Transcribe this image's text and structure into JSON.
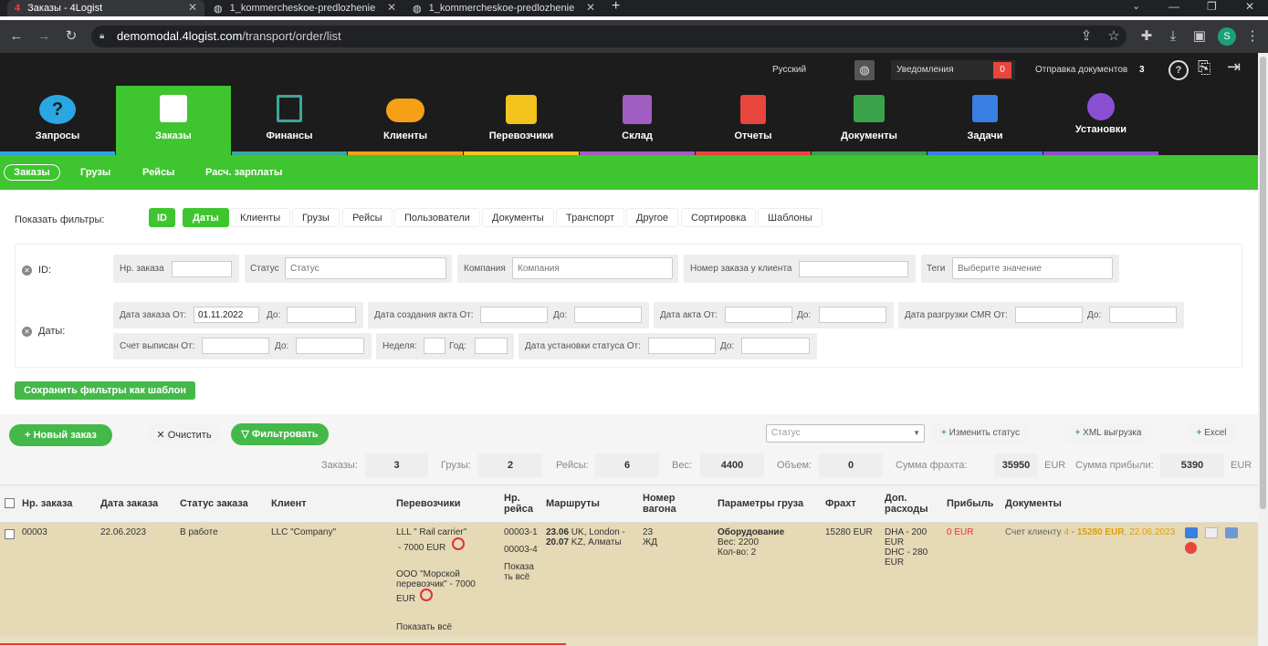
{
  "browser": {
    "tabs": [
      {
        "label": "Заказы - 4Logist"
      },
      {
        "label": "1_kommercheskoe-predlozhenie"
      },
      {
        "label": "1_kommercheskoe-predlozhenie"
      }
    ],
    "url_host": "demomodal.4logist.com",
    "url_path": "/transport/order/list",
    "profile_initial": "S"
  },
  "topbar": {
    "language": "Русский",
    "notifications_label": "Уведомления",
    "notifications_count": "0",
    "docs_label": "Отправка документов",
    "docs_count": "3"
  },
  "nav": [
    {
      "label": "Запросы",
      "color": "#2aa7e3"
    },
    {
      "label": "Заказы",
      "color": "#3fc52f"
    },
    {
      "label": "Финансы",
      "color": "#3aa79a"
    },
    {
      "label": "Клиенты",
      "color": "#f6a018"
    },
    {
      "label": "Перевозчики",
      "color": "#f3c31e"
    },
    {
      "label": "Склад",
      "color": "#a05ec2"
    },
    {
      "label": "Отчеты",
      "color": "#e8453c"
    },
    {
      "label": "Документы",
      "color": "#3aa34a"
    },
    {
      "label": "Задачи",
      "color": "#3a7fe3"
    },
    {
      "label": "Установки",
      "color": "#8a4fd3"
    }
  ],
  "subnav": [
    "Заказы",
    "Грузы",
    "Рейсы",
    "Расч. зарплаты"
  ],
  "filters": {
    "show_label": "Показать фильтры:",
    "buttons": [
      "ID",
      "Даты",
      "Клиенты",
      "Грузы",
      "Рейсы",
      "Пользователи",
      "Документы",
      "Транспорт",
      "Другое",
      "Сортировка",
      "Шаблоны"
    ],
    "id_row": {
      "title": "ID:",
      "order_no": "Нр. заказа",
      "status": "Статус",
      "status_ph": "Статус",
      "company": "Компания",
      "company_ph": "Компания",
      "client_order": "Номер заказа у клиента",
      "tags": "Теги",
      "tags_ph": "Выберите значение"
    },
    "dates_row": {
      "title": "Даты:",
      "order_date_from": "Дата заказа От:",
      "order_date_value": "01.11.2022",
      "to": "До:",
      "act_created_from": "Дата создания акта От:",
      "act_date_from": "Дата акта От:",
      "cmr_from": "Дата разгрузки CMR От:",
      "invoice_from": "Счет выписан От:",
      "week": "Неделя:",
      "year": "Год:",
      "status_date_from": "Дата установки статуса От:"
    },
    "save_template": "Сохранить фильтры как шаблон"
  },
  "actions": {
    "new_order": "Новый заказ",
    "clear": "Очистить",
    "filter": "Фильтровать",
    "status_select": "Статус",
    "change_status": "Изменить статус",
    "xml": "XML выгрузка",
    "excel": "Excel"
  },
  "stats": {
    "orders_label": "Заказы:",
    "orders": "3",
    "cargo_label": "Грузы:",
    "cargo": "2",
    "trips_label": "Рейсы:",
    "trips": "6",
    "weight_label": "Вес:",
    "weight": "4400",
    "volume_label": "Объем:",
    "volume": "0",
    "freight_label": "Сумма фрахта:",
    "freight": "35950",
    "freight_cur": "EUR",
    "profit_label": "Сумма прибыли:",
    "profit": "5390",
    "profit_cur": "EUR"
  },
  "table": {
    "headers": [
      "Нр. заказа",
      "Дата заказа",
      "Статус заказа",
      "Клиент",
      "Перевозчики",
      "Нр. рейса",
      "Маршруты",
      "Номер вагона",
      "Параметры груза",
      "Фрахт",
      "Доп. расходы",
      "Прибыль",
      "Документы"
    ],
    "row": {
      "order": "00003",
      "date": "22.06.2023",
      "status": "В работе",
      "client": "LLC \"Company\"",
      "carrier1": "LLL \" Rail carrier\"",
      "carrier1_amount": "- 7000 EUR",
      "carrier2_a": "ООО \"Морской",
      "carrier2_b": "перевозчик\" - 7000",
      "carrier2_c": "EUR",
      "show_all": "Показать всё",
      "trip1": "00003-1",
      "trip2": "00003-4",
      "trip_show_a": "Показа",
      "trip_show_b": "ть всё",
      "route1_date": "23.06",
      "route1": " UK, London -",
      "route2_date": "20.07",
      "route2": " KZ, Алматы",
      "wagon1": "23",
      "wagon2": "ЖД",
      "cargo_name": "Оборудование",
      "cargo_weight": "Вес: 2200",
      "cargo_qty": "Кол-во: 2",
      "freight": "15280 EUR",
      "extra1": "DHA - 200",
      "extra2": "EUR",
      "extra3": "DHC - 280",
      "extra4": "EUR",
      "profit": "0 EUR",
      "doc_prefix": "Счет клиенту ",
      "doc_num": "4",
      "doc_sep": " - ",
      "doc_amount": "15280 EUR",
      "doc_date": ", 22.06.2023"
    }
  }
}
